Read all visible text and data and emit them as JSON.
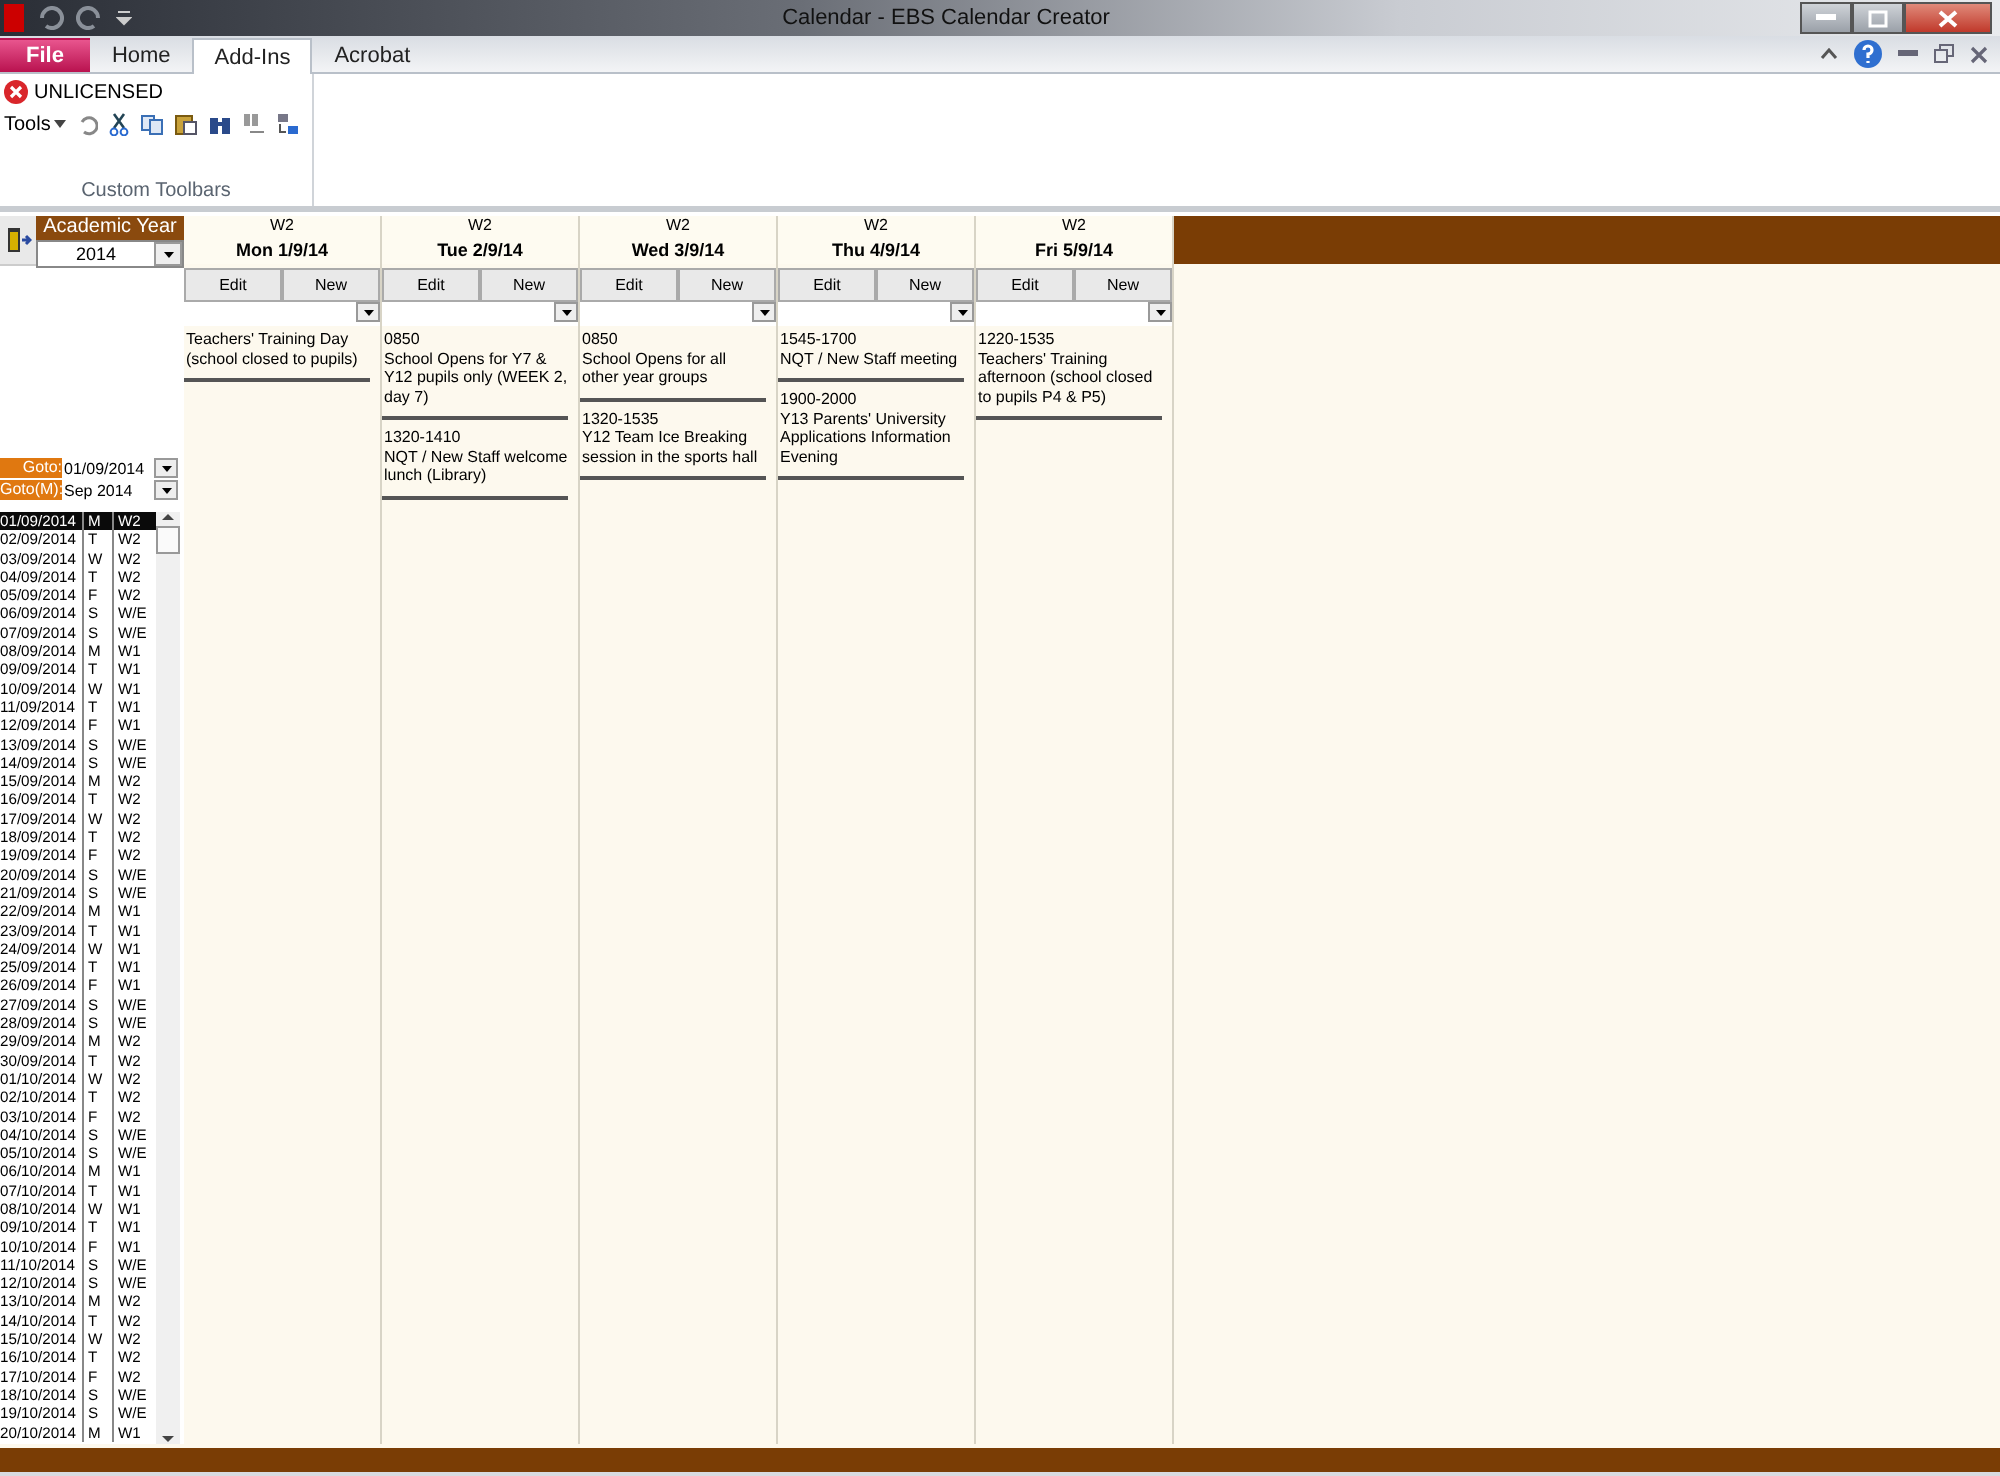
{
  "window": {
    "title": "Calendar  -  EBS Calendar Creator"
  },
  "ribbon_tabs": [
    {
      "label": "File",
      "kind": "file",
      "selected": false
    },
    {
      "label": "Home",
      "kind": "tab",
      "selected": false
    },
    {
      "label": "Add-Ins",
      "kind": "tab",
      "selected": true
    },
    {
      "label": "Acrobat",
      "kind": "tab",
      "selected": false
    }
  ],
  "ribbon": {
    "license": "UNLICENSED",
    "tools_menu": "Tools",
    "group_label": "Custom Toolbars"
  },
  "sidebar": {
    "academic_year_label": "Academic Year",
    "academic_year": "2014",
    "goto_label": "Goto:",
    "goto_value": "01/09/2014",
    "goto_month_label": "Goto(M):",
    "goto_month_value": "Sep 2014",
    "dates": [
      {
        "date": "01/09/2014",
        "day": "M",
        "week": "W2",
        "selected": true
      },
      {
        "date": "02/09/2014",
        "day": "T",
        "week": "W2",
        "selected": false
      },
      {
        "date": "03/09/2014",
        "day": "W",
        "week": "W2",
        "selected": false
      },
      {
        "date": "04/09/2014",
        "day": "T",
        "week": "W2",
        "selected": false
      },
      {
        "date": "05/09/2014",
        "day": "F",
        "week": "W2",
        "selected": false
      },
      {
        "date": "06/09/2014",
        "day": "S",
        "week": "W/E",
        "selected": false
      },
      {
        "date": "07/09/2014",
        "day": "S",
        "week": "W/E",
        "selected": false
      },
      {
        "date": "08/09/2014",
        "day": "M",
        "week": "W1",
        "selected": false
      },
      {
        "date": "09/09/2014",
        "day": "T",
        "week": "W1",
        "selected": false
      },
      {
        "date": "10/09/2014",
        "day": "W",
        "week": "W1",
        "selected": false
      },
      {
        "date": "11/09/2014",
        "day": "T",
        "week": "W1",
        "selected": false
      },
      {
        "date": "12/09/2014",
        "day": "F",
        "week": "W1",
        "selected": false
      },
      {
        "date": "13/09/2014",
        "day": "S",
        "week": "W/E",
        "selected": false
      },
      {
        "date": "14/09/2014",
        "day": "S",
        "week": "W/E",
        "selected": false
      },
      {
        "date": "15/09/2014",
        "day": "M",
        "week": "W2",
        "selected": false
      },
      {
        "date": "16/09/2014",
        "day": "T",
        "week": "W2",
        "selected": false
      },
      {
        "date": "17/09/2014",
        "day": "W",
        "week": "W2",
        "selected": false
      },
      {
        "date": "18/09/2014",
        "day": "T",
        "week": "W2",
        "selected": false
      },
      {
        "date": "19/09/2014",
        "day": "F",
        "week": "W2",
        "selected": false
      },
      {
        "date": "20/09/2014",
        "day": "S",
        "week": "W/E",
        "selected": false
      },
      {
        "date": "21/09/2014",
        "day": "S",
        "week": "W/E",
        "selected": false
      },
      {
        "date": "22/09/2014",
        "day": "M",
        "week": "W1",
        "selected": false
      },
      {
        "date": "23/09/2014",
        "day": "T",
        "week": "W1",
        "selected": false
      },
      {
        "date": "24/09/2014",
        "day": "W",
        "week": "W1",
        "selected": false
      },
      {
        "date": "25/09/2014",
        "day": "T",
        "week": "W1",
        "selected": false
      },
      {
        "date": "26/09/2014",
        "day": "F",
        "week": "W1",
        "selected": false
      },
      {
        "date": "27/09/2014",
        "day": "S",
        "week": "W/E",
        "selected": false
      },
      {
        "date": "28/09/2014",
        "day": "S",
        "week": "W/E",
        "selected": false
      },
      {
        "date": "29/09/2014",
        "day": "M",
        "week": "W2",
        "selected": false
      },
      {
        "date": "30/09/2014",
        "day": "T",
        "week": "W2",
        "selected": false
      },
      {
        "date": "01/10/2014",
        "day": "W",
        "week": "W2",
        "selected": false
      },
      {
        "date": "02/10/2014",
        "day": "T",
        "week": "W2",
        "selected": false
      },
      {
        "date": "03/10/2014",
        "day": "F",
        "week": "W2",
        "selected": false
      },
      {
        "date": "04/10/2014",
        "day": "S",
        "week": "W/E",
        "selected": false
      },
      {
        "date": "05/10/2014",
        "day": "S",
        "week": "W/E",
        "selected": false
      },
      {
        "date": "06/10/2014",
        "day": "M",
        "week": "W1",
        "selected": false
      },
      {
        "date": "07/10/2014",
        "day": "T",
        "week": "W1",
        "selected": false
      },
      {
        "date": "08/10/2014",
        "day": "W",
        "week": "W1",
        "selected": false
      },
      {
        "date": "09/10/2014",
        "day": "T",
        "week": "W1",
        "selected": false
      },
      {
        "date": "10/10/2014",
        "day": "F",
        "week": "W1",
        "selected": false
      },
      {
        "date": "11/10/2014",
        "day": "S",
        "week": "W/E",
        "selected": false
      },
      {
        "date": "12/10/2014",
        "day": "S",
        "week": "W/E",
        "selected": false
      },
      {
        "date": "13/10/2014",
        "day": "M",
        "week": "W2",
        "selected": false
      },
      {
        "date": "14/10/2014",
        "day": "T",
        "week": "W2",
        "selected": false
      },
      {
        "date": "15/10/2014",
        "day": "W",
        "week": "W2",
        "selected": false
      },
      {
        "date": "16/10/2014",
        "day": "T",
        "week": "W2",
        "selected": false
      },
      {
        "date": "17/10/2014",
        "day": "F",
        "week": "W2",
        "selected": false
      },
      {
        "date": "18/10/2014",
        "day": "S",
        "week": "W/E",
        "selected": false
      },
      {
        "date": "19/10/2014",
        "day": "S",
        "week": "W/E",
        "selected": false
      },
      {
        "date": "20/10/2014",
        "day": "M",
        "week": "W1",
        "selected": false
      }
    ]
  },
  "days": [
    {
      "week": "W2",
      "date": "Mon 1/9/14",
      "edit": "Edit",
      "new": "New",
      "events": [
        {
          "title": "Teachers' Training Day (school closed to pupils)"
        }
      ]
    },
    {
      "week": "W2",
      "date": "Tue 2/9/14",
      "edit": "Edit",
      "new": "New",
      "events": [
        {
          "time": "0850",
          "title": "School Opens for Y7 & Y12 pupils only (WEEK 2, day 7)"
        },
        {
          "time": "1320-1410",
          "title": "NQT / New Staff welcome lunch (Library)"
        }
      ]
    },
    {
      "week": "W2",
      "date": "Wed 3/9/14",
      "edit": "Edit",
      "new": "New",
      "events": [
        {
          "time": "0850",
          "title": "School Opens for all other year groups"
        },
        {
          "time": "1320-1535",
          "title": "Y12 Team Ice Breaking session in the sports hall"
        }
      ]
    },
    {
      "week": "W2",
      "date": "Thu 4/9/14",
      "edit": "Edit",
      "new": "New",
      "events": [
        {
          "time": "1545-1700",
          "title": "NQT / New Staff meeting"
        },
        {
          "time": "1900-2000",
          "title": "Y13 Parents' University Applications Information Evening"
        }
      ]
    },
    {
      "week": "W2",
      "date": "Fri 5/9/14",
      "edit": "Edit",
      "new": "New",
      "events": [
        {
          "time": "1220-1535",
          "title": "Teachers' Training afternoon (school closed to pupils P4 & P5)"
        }
      ]
    }
  ]
}
